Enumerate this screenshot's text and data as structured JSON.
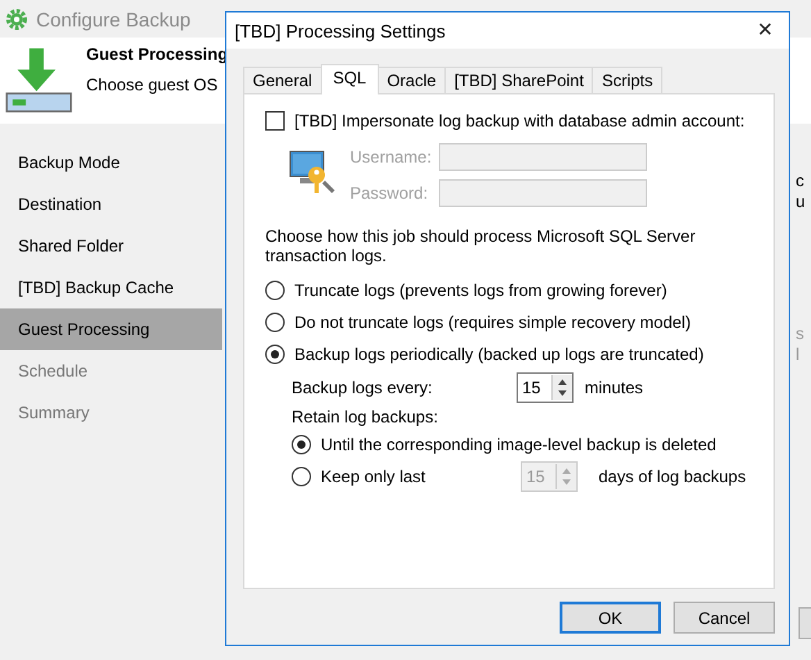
{
  "window": {
    "title": "Configure Backup"
  },
  "header": {
    "title": "Guest Processing",
    "subtitle": "Choose guest OS"
  },
  "sidebar": {
    "items": [
      {
        "label": "Backup Mode",
        "selected": false,
        "disabled": false
      },
      {
        "label": "Destination",
        "selected": false,
        "disabled": false
      },
      {
        "label": "Shared Folder",
        "selected": false,
        "disabled": false
      },
      {
        "label": "[TBD] Backup Cache",
        "selected": false,
        "disabled": false
      },
      {
        "label": "Guest Processing",
        "selected": true,
        "disabled": false
      },
      {
        "label": "Schedule",
        "selected": false,
        "disabled": true
      },
      {
        "label": "Summary",
        "selected": false,
        "disabled": true
      }
    ]
  },
  "background_fragments": [
    {
      "text": "c",
      "disabled": false
    },
    {
      "text": "u",
      "disabled": false
    },
    {
      "text": "s",
      "disabled": true
    },
    {
      "text": "l",
      "disabled": true
    }
  ],
  "dialog": {
    "title": "[TBD] Processing Settings",
    "close": "✕",
    "tabs": [
      {
        "label": "General",
        "selected": false
      },
      {
        "label": "SQL",
        "selected": true
      },
      {
        "label": "Oracle",
        "selected": false
      },
      {
        "label": "[TBD] SharePoint",
        "selected": false
      },
      {
        "label": "Scripts",
        "selected": false
      }
    ],
    "impersonate": {
      "label": "[TBD] Impersonate log backup with database admin account:",
      "checked": false
    },
    "credentials": [
      {
        "label": "Username:",
        "disabled": true
      },
      {
        "label": "Password:",
        "disabled": true
      }
    ],
    "description": "Choose how this job should process Microsoft SQL Server transaction logs.",
    "log_options": [
      {
        "label": "Truncate logs (prevents logs from growing forever)",
        "selected": false
      },
      {
        "label": "Do not truncate logs (requires simple recovery model)",
        "selected": false
      },
      {
        "label": "Backup logs periodically (backed up logs are truncated)",
        "selected": true
      }
    ],
    "interval": {
      "label": "Backup logs every:",
      "value": "15",
      "unit": "minutes",
      "disabled": false
    },
    "retain": {
      "label": "Retain log backups:",
      "options": [
        {
          "label": "Until the corresponding image-level backup is deleted",
          "selected": true
        },
        {
          "label": "Keep only last",
          "selected": false,
          "spinner": {
            "value": "15",
            "disabled": true
          },
          "unit": "days of log backups"
        }
      ]
    },
    "buttons": [
      {
        "label": "OK",
        "default": true
      },
      {
        "label": "Cancel",
        "default": false
      }
    ]
  }
}
